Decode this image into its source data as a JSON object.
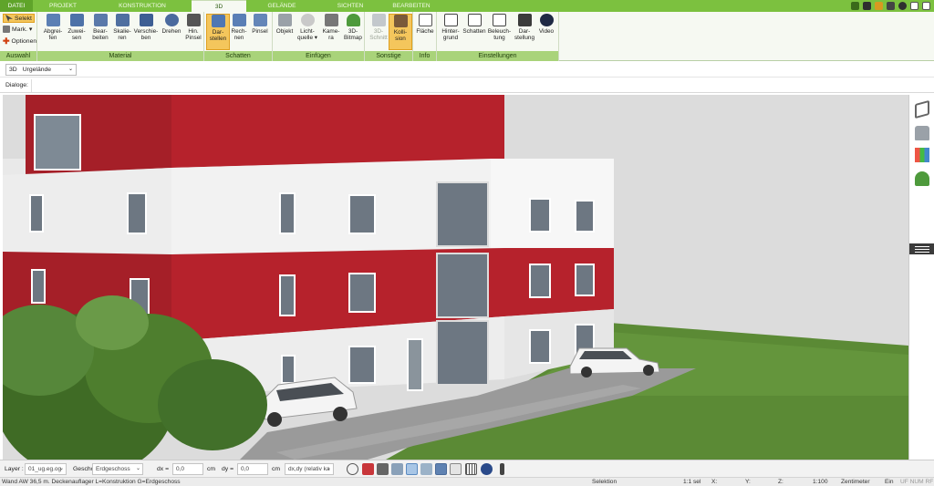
{
  "menu": {
    "tabs": [
      "DATEI",
      "PROJEKT",
      "KONSTRUKTION",
      "3D",
      "GELÄNDE",
      "SICHTEN",
      "BEARBEITEN"
    ],
    "active_tab": "3D"
  },
  "ribbon": {
    "auswahl": {
      "label": "Auswahl",
      "selekt": "Selekt",
      "mark": "Mark. ▾",
      "optionen": "Optionen"
    },
    "material": {
      "label": "Material",
      "buttons": [
        "Abgrei-\nfen",
        "Zuwei-\nsen",
        "Bear-\nbeiten",
        "Skalie-\nren",
        "Verschie-\nben",
        "Drehen",
        "Hin.\nPinsel"
      ]
    },
    "schatten": {
      "label": "Schatten",
      "buttons": [
        "Dar-\nstellen",
        "Rech-\nnen",
        "Pinsel"
      ]
    },
    "einfuegen": {
      "label": "Einfügen",
      "buttons": [
        "Objekt",
        "Licht-\nquelle ▾",
        "Kame-\nra",
        "3D-\nBitmap"
      ]
    },
    "sonstige": {
      "label": "Sonstige",
      "buttons": [
        "3D-\nSchnitt",
        "Kolli-\nsion"
      ]
    },
    "info": {
      "label": "Info",
      "buttons": [
        "Fläche"
      ]
    },
    "einstellungen": {
      "label": "Einstellungen",
      "buttons": [
        "Hinter-\ngrund",
        "Schatten",
        "Beleuch-\ntung",
        "Dar-\nstellung",
        "Video"
      ]
    }
  },
  "view_bar": {
    "view_label": "3D",
    "view_value": "Urgelände"
  },
  "dialog_bar": {
    "label": "Dialoge:"
  },
  "bottom_toolbar": {
    "layer_label": "Layer :",
    "layer_value": "01_ug.eg.og",
    "geschoss_label": "Geschoss :",
    "geschoss_value": "Erdgeschoss",
    "dx_label": "dx =",
    "dx_value": "0,0",
    "dx_unit": "cm",
    "dy_label": "dy =",
    "dy_value": "0,0",
    "dy_unit": "cm",
    "mode_value": "dx,dy (relativ ka"
  },
  "status_bar": {
    "message": "Wand AW 36,5 m. Deckenauflager L=Konstruktion G=Erdgeschoss",
    "mode": "Selektion",
    "selection": "1:1 sel",
    "x_label": "X:",
    "y_label": "Y:",
    "z_label": "Z:",
    "scale": "1:100",
    "unit": "Zentimeter",
    "ein": "Ein",
    "flags": "UF NUM RF"
  },
  "colors": {
    "tab_green": "#7cc13f",
    "group_label_green": "#a9d37a",
    "active_button": "#f4c65c",
    "facade_red": "#b0202a",
    "facade_white": "#f1f1f1",
    "lawn": "#5b8a35"
  }
}
